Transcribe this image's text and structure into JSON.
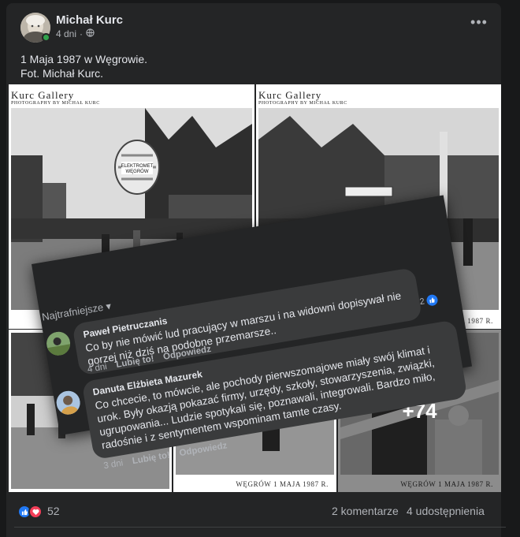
{
  "post": {
    "author": "Michał Kurc",
    "time": "4 dni",
    "dot": "·",
    "caption_line1": "1 Maja 1987 w Węgrowie.",
    "caption_line2": "Fot. Michał Kurc.",
    "more_label": "•••"
  },
  "photos": {
    "gallery_title": "Kurc Gallery",
    "gallery_subtitle": "PHOTOGRAPHY BY MICHAŁ KURC",
    "footer": "WĘGRÓW 1 MAJA 1987 R.",
    "balloon_text_1": "ELEKTROMET",
    "balloon_text_2": "WĘGRÓW",
    "more_count": "+74"
  },
  "stats": {
    "reactions": "52",
    "comments": "2 komentarze",
    "shares": "4 udostępnienia"
  },
  "comments": {
    "sort_label": "Najtrafniejsze",
    "like_label": "Lubię to!",
    "reply_label": "Odpowiedz",
    "items": [
      {
        "name": "Paweł Pietruczanis",
        "text": "Co by nie mówić lud pracujący w marszu i na widowni dopisywał nie gorzej niż dziś na podobne przemarsze..",
        "time": "4 dni",
        "reactions": "2"
      },
      {
        "name": "Danuta Elżbieta Mazurek",
        "text": "Co chcecie, to mówcie, ale pochody pierwszomajowe miały swój klimat i urok. Były okazją pokazać firmy, urzędy, szkoły, stowarzyszenia, związki, ugrupowania... Ludzie spotykali się, poznawali, integrowali. Bardzo miło, radośnie i z sentymentem wspominam tamte czasy.",
        "time": "3 dni"
      }
    ]
  },
  "colors": {
    "page_bg": "#18191a",
    "card_bg": "#242526",
    "bubble_bg": "#3a3b3c",
    "like_blue": "#2078f4",
    "love_red": "#f33e58",
    "online_green": "#31a24c"
  }
}
